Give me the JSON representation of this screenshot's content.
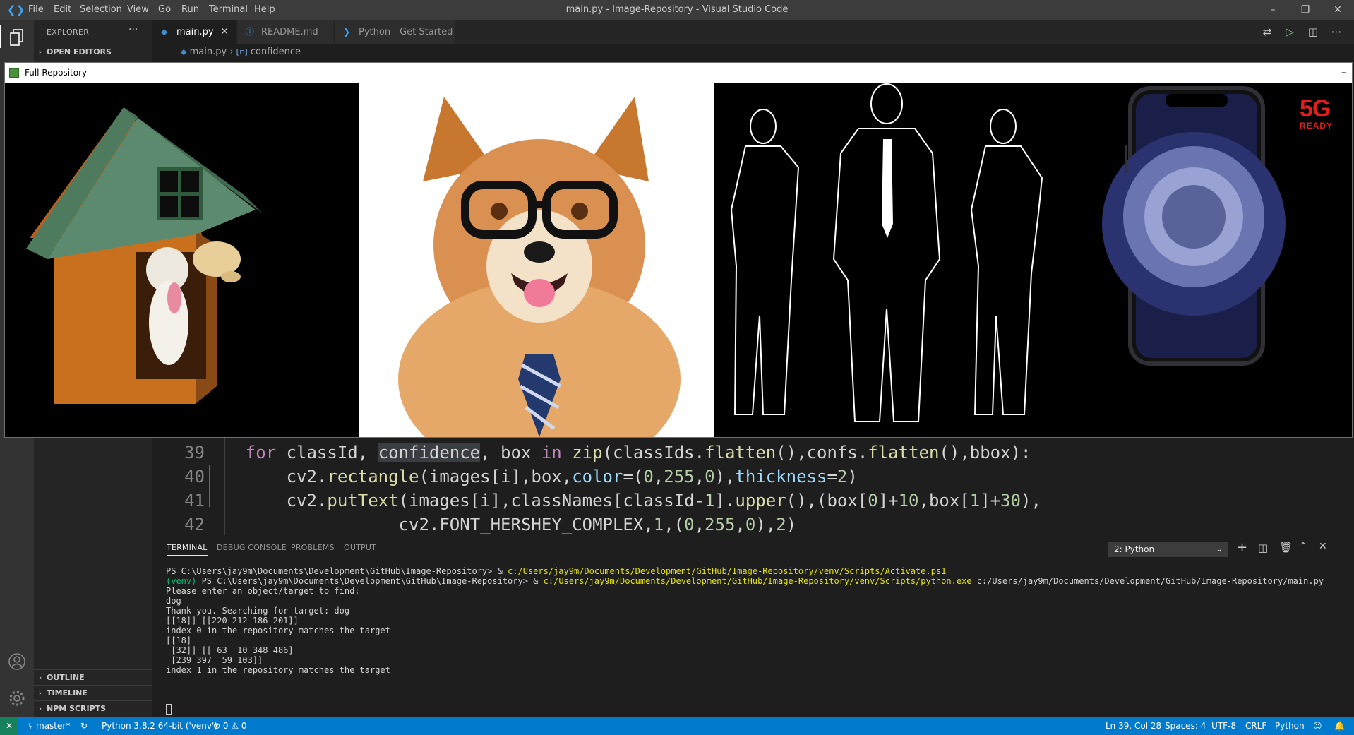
{
  "window": {
    "title": "main.py - Image-Repository - Visual Studio Code",
    "menu": [
      "File",
      "Edit",
      "Selection",
      "View",
      "Go",
      "Run",
      "Terminal",
      "Help"
    ]
  },
  "sidebar": {
    "title": "EXPLORER",
    "more": "···",
    "sections": {
      "open_editors": "OPEN EDITORS",
      "outline": "OUTLINE",
      "timeline": "TIMELINE",
      "npm_scripts": "NPM SCRIPTS"
    }
  },
  "tabs": [
    {
      "label": "main.py",
      "icon": "python-file-icon",
      "active": true
    },
    {
      "label": "README.md",
      "icon": "info-icon",
      "active": false
    },
    {
      "label": "Python - Get Started",
      "icon": "vscode-icon",
      "active": false
    }
  ],
  "breadcrumb": {
    "file": "main.py",
    "symbol": "confidence"
  },
  "image_window": {
    "title": "Full Repository",
    "panels": [
      "dog-house-image",
      "shiba-with-glasses-image",
      "business-silhouettes-image",
      "smartphone-image"
    ],
    "badge_main": "5G",
    "badge_sub": "READY"
  },
  "editor": {
    "lines": [
      {
        "num": "39",
        "indent": "    ",
        "tokens": [
          [
            "kw",
            "for "
          ],
          [
            "tx",
            "classId, "
          ],
          [
            "tx",
            "confidence"
          ],
          [
            "tx",
            ", box "
          ],
          [
            "kw",
            "in "
          ],
          [
            "fn",
            "zip"
          ],
          [
            "tx",
            "(classIds."
          ],
          [
            "fn",
            "flatten"
          ],
          [
            "tx",
            "(),confs."
          ],
          [
            "fn",
            "flatten"
          ],
          [
            "tx",
            "(),bbox):"
          ]
        ]
      },
      {
        "num": "40",
        "indent": "        ",
        "tokens": [
          [
            "tx",
            "cv2."
          ],
          [
            "fn",
            "rectangle"
          ],
          [
            "tx",
            "(images[i],box,"
          ],
          [
            "pm",
            "color"
          ],
          [
            "tx",
            "=("
          ],
          [
            "nm",
            "0"
          ],
          [
            "tx",
            ","
          ],
          [
            "nm",
            "255"
          ],
          [
            "tx",
            ","
          ],
          [
            "nm",
            "0"
          ],
          [
            "tx",
            "),"
          ],
          [
            "pm",
            "thickness"
          ],
          [
            "tx",
            "="
          ],
          [
            "nm",
            "2"
          ],
          [
            "tx",
            ")"
          ]
        ]
      },
      {
        "num": "41",
        "indent": "        ",
        "tokens": [
          [
            "tx",
            "cv2."
          ],
          [
            "fn",
            "putText"
          ],
          [
            "tx",
            "(images[i],classNames[classId-"
          ],
          [
            "nm",
            "1"
          ],
          [
            "tx",
            "]."
          ],
          [
            "fn",
            "upper"
          ],
          [
            "tx",
            "(),(box["
          ],
          [
            "nm",
            "0"
          ],
          [
            "tx",
            "]+"
          ],
          [
            "nm",
            "10"
          ],
          [
            "tx",
            ",box["
          ],
          [
            "nm",
            "1"
          ],
          [
            "tx",
            "]+"
          ],
          [
            "nm",
            "30"
          ],
          [
            "tx",
            "),"
          ]
        ]
      },
      {
        "num": "42",
        "indent": "                   ",
        "tokens": [
          [
            "tx",
            "cv2.FONT_HERSHEY_COMPLEX,"
          ],
          [
            "nm",
            "1"
          ],
          [
            "tx",
            ",("
          ],
          [
            "nm",
            "0"
          ],
          [
            "tx",
            ","
          ],
          [
            "nm",
            "255"
          ],
          [
            "tx",
            ","
          ],
          [
            "nm",
            "0"
          ],
          [
            "tx",
            "),"
          ],
          [
            "nm",
            "2"
          ],
          [
            "tx",
            ")"
          ]
        ]
      }
    ]
  },
  "panel": {
    "tabs": [
      "TERMINAL",
      "DEBUG CONSOLE",
      "PROBLEMS",
      "OUTPUT"
    ],
    "terminal_select": "2: Python",
    "terminal_lines": [
      [
        [
          "tx",
          "PS C:\\Users\\jay9m\\Documents\\Development\\GitHub\\Image-Repository> & "
        ],
        [
          "ty",
          "c:/Users/jay9m/Documents/Development/GitHub/Image-Repository/venv/Scripts/Activate.ps1"
        ]
      ],
      [
        [
          "tg",
          "(venv) "
        ],
        [
          "tx",
          "PS C:\\Users\\jay9m\\Documents\\Development\\GitHub\\Image-Repository> & "
        ],
        [
          "ty",
          "c:/Users/jay9m/Documents/Development/GitHub/Image-Repository/venv/Scripts/python.exe"
        ],
        [
          "tx",
          " c:/Users/jay9m/Documents/Development/GitHub/Image-Repository/main.py"
        ]
      ],
      [
        [
          "tx",
          "Please enter an object/target to find:"
        ]
      ],
      [
        [
          "tx",
          "dog"
        ]
      ],
      [
        [
          "tx",
          "Thank you. Searching for target: dog"
        ]
      ],
      [
        [
          "tx",
          "[[18]] [[220 212 186 201]]"
        ]
      ],
      [
        [
          "tx",
          "index 0 in the repository matches the target"
        ]
      ],
      [
        [
          "tx",
          "[[18]"
        ]
      ],
      [
        [
          "tx",
          " [32]] [[ 63  10 348 486]"
        ]
      ],
      [
        [
          "tx",
          " [239 397  59 103]]"
        ]
      ],
      [
        [
          "tx",
          "index 1 in the repository matches the target"
        ]
      ]
    ]
  },
  "statusbar": {
    "branch": "master*",
    "python": "Python 3.8.2 64-bit ('venv')",
    "errors": "0",
    "warnings": "0",
    "position": "Ln 39, Col 28",
    "spaces": "Spaces: 4",
    "encoding": "UTF-8",
    "eol": "CRLF",
    "language": "Python"
  },
  "colors": {
    "accent": "#007acc",
    "titlebar": "#3c3c3c",
    "activity": "#333333",
    "sidebar": "#252526",
    "editor": "#1e1e1e"
  }
}
